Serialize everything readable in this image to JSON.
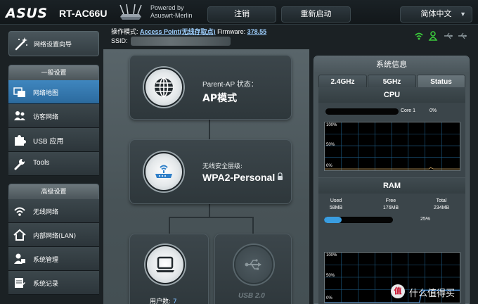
{
  "header": {
    "brand": "ASUS",
    "model": "RT-AC66U",
    "powered_by": "Powered by",
    "firmware_name": "Asuswrt-Merlin",
    "logout_label": "注销",
    "reboot_label": "重新启动",
    "language_label": "简体中文"
  },
  "sidebar": {
    "quick_setup": "网络设置向导",
    "general_title": "一般设置",
    "general_items": [
      {
        "label": "网络地图",
        "icon": "network-map-icon",
        "active": true
      },
      {
        "label": "访客网络",
        "icon": "guest-network-icon",
        "active": false
      },
      {
        "label": "USB 应用",
        "icon": "puzzle-icon",
        "active": false
      },
      {
        "label": "Tools",
        "icon": "wrench-icon",
        "active": false
      }
    ],
    "advanced_title": "高级设置",
    "advanced_items": [
      {
        "label": "无线网络",
        "icon": "wifi-icon"
      },
      {
        "label": "内部网络(LAN)",
        "icon": "home-icon"
      },
      {
        "label": "系统管理",
        "icon": "admin-icon"
      },
      {
        "label": "系统记录",
        "icon": "log-icon"
      }
    ]
  },
  "status": {
    "mode_label": "操作模式:",
    "mode_value": "Access Point(无线存取点)",
    "firmware_label": "Firmware:",
    "firmware_value": "378.55",
    "ssid_label": "SSID:"
  },
  "map": {
    "ap_status_label": "Parent-AP 状态：",
    "ap_status_value": "AP模式",
    "security_label": "无线安全层级:",
    "security_value": "WPA2-Personal",
    "clients_label": "用户数:",
    "clients_value": "7",
    "usb_label": "USB 2.0"
  },
  "system_info": {
    "title": "系统信息",
    "tabs": [
      "2.4GHz",
      "5GHz",
      "Status"
    ],
    "active_tab": "Status",
    "cpu": {
      "title": "CPU",
      "core_label": "Core 1",
      "usage_percent": "0%",
      "graph_labels": [
        "100%",
        "50%",
        "0%"
      ]
    },
    "ram": {
      "title": "RAM",
      "used_label": "Used",
      "used_value": "58MB",
      "free_label": "Free",
      "free_value": "176MB",
      "total_label": "Total",
      "total_value": "234MB",
      "usage_percent": "25%",
      "usage_fraction": 0.25,
      "graph_labels": [
        "100%",
        "50%",
        "0%"
      ]
    }
  },
  "colors": {
    "accent_blue": "#3a9de0",
    "active_menu": "#3f86bf",
    "graph_line": "#4a90d9",
    "status_green": "#3ccd3c"
  },
  "watermark": {
    "icon_char": "值",
    "text": "什么值得买"
  }
}
